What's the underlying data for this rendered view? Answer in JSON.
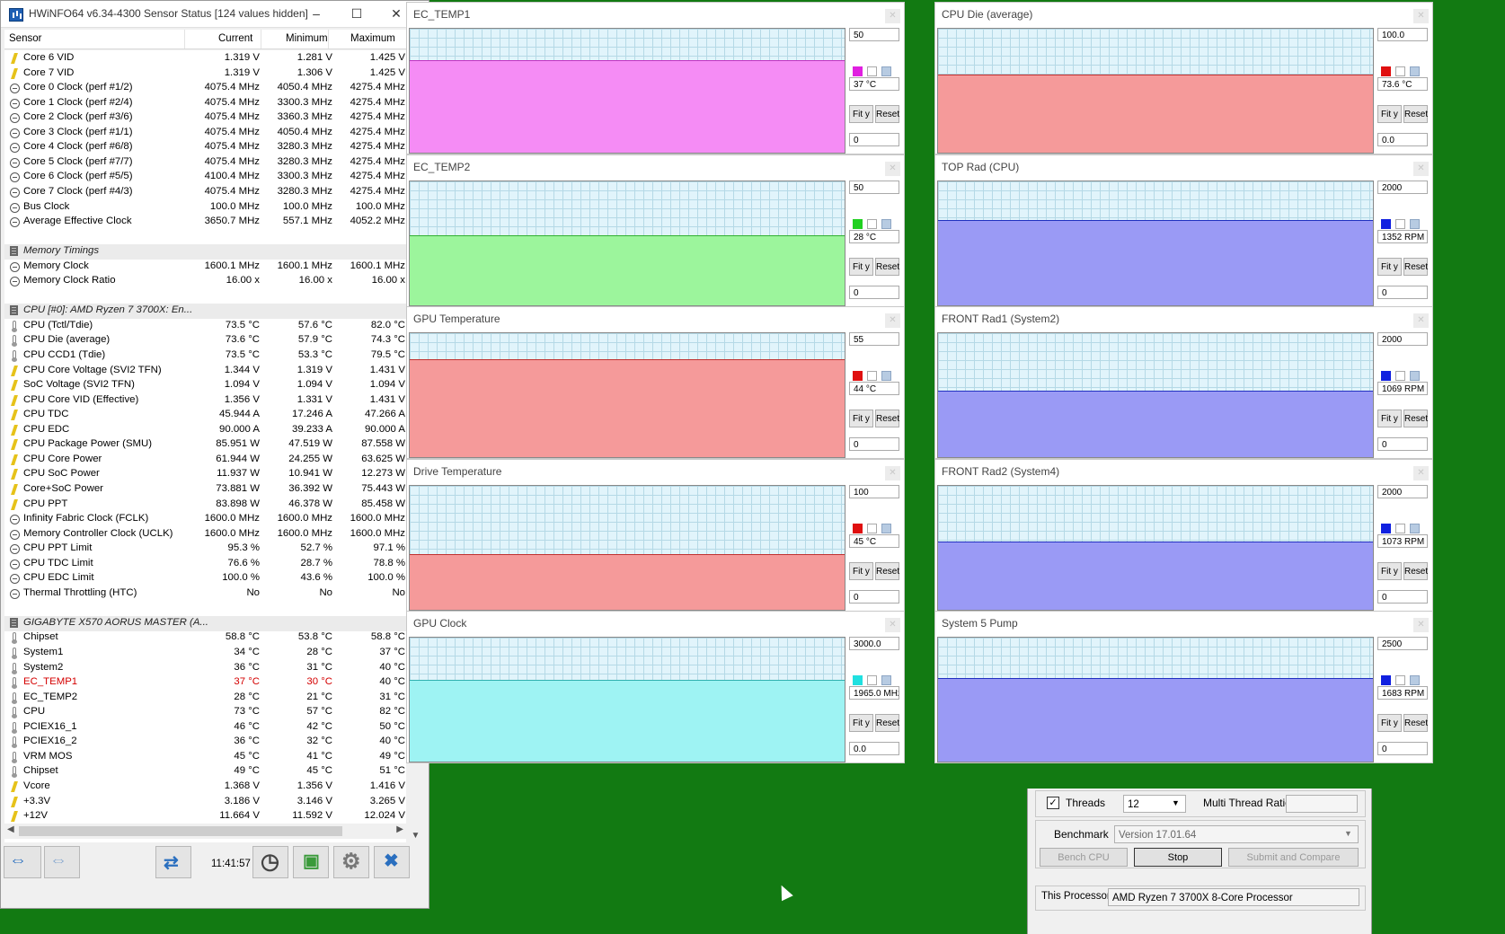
{
  "main_window": {
    "title": "HWiNFO64 v6.34-4300 Sensor Status [124 values hidden]",
    "columns": {
      "sensor": "Sensor",
      "current": "Current",
      "minimum": "Minimum",
      "maximum": "Maximum"
    },
    "rows": [
      {
        "icon": "volt",
        "name": "Core 6 VID",
        "cur": "1.319 V",
        "min": "1.281 V",
        "max": "1.425 V"
      },
      {
        "icon": "volt",
        "name": "Core 7 VID",
        "cur": "1.319 V",
        "min": "1.306 V",
        "max": "1.425 V"
      },
      {
        "icon": "clk",
        "name": "Core 0 Clock (perf #1/2)",
        "cur": "4075.4 MHz",
        "min": "4050.4 MHz",
        "max": "4275.4 MHz"
      },
      {
        "icon": "clk",
        "name": "Core 1 Clock (perf #2/4)",
        "cur": "4075.4 MHz",
        "min": "3300.3 MHz",
        "max": "4275.4 MHz"
      },
      {
        "icon": "clk",
        "name": "Core 2 Clock (perf #3/6)",
        "cur": "4075.4 MHz",
        "min": "3360.3 MHz",
        "max": "4275.4 MHz"
      },
      {
        "icon": "clk",
        "name": "Core 3 Clock (perf #1/1)",
        "cur": "4075.4 MHz",
        "min": "4050.4 MHz",
        "max": "4275.4 MHz"
      },
      {
        "icon": "clk",
        "name": "Core 4 Clock (perf #6/8)",
        "cur": "4075.4 MHz",
        "min": "3280.3 MHz",
        "max": "4275.4 MHz"
      },
      {
        "icon": "clk",
        "name": "Core 5 Clock (perf #7/7)",
        "cur": "4075.4 MHz",
        "min": "3280.3 MHz",
        "max": "4275.4 MHz"
      },
      {
        "icon": "clk",
        "name": "Core 6 Clock (perf #5/5)",
        "cur": "4100.4 MHz",
        "min": "3300.3 MHz",
        "max": "4275.4 MHz"
      },
      {
        "icon": "clk",
        "name": "Core 7 Clock (perf #4/3)",
        "cur": "4075.4 MHz",
        "min": "3280.3 MHz",
        "max": "4275.4 MHz"
      },
      {
        "icon": "clk",
        "name": "Bus Clock",
        "cur": "100.0 MHz",
        "min": "100.0 MHz",
        "max": "100.0 MHz"
      },
      {
        "icon": "clk",
        "name": "Average Effective Clock",
        "cur": "3650.7 MHz",
        "min": "557.1 MHz",
        "max": "4052.2 MHz"
      },
      {
        "icon": "",
        "name": "",
        "cur": "",
        "min": "",
        "max": ""
      },
      {
        "icon": "grp",
        "group": true,
        "name": "Memory Timings",
        "cur": "",
        "min": "",
        "max": ""
      },
      {
        "icon": "clk",
        "name": "Memory Clock",
        "cur": "1600.1 MHz",
        "min": "1600.1 MHz",
        "max": "1600.1 MHz"
      },
      {
        "icon": "clk",
        "name": "Memory Clock Ratio",
        "cur": "16.00 x",
        "min": "16.00 x",
        "max": "16.00 x"
      },
      {
        "icon": "",
        "name": "",
        "cur": "",
        "min": "",
        "max": ""
      },
      {
        "icon": "grp",
        "group": true,
        "name": "CPU [#0]: AMD Ryzen 7 3700X: En...",
        "cur": "",
        "min": "",
        "max": ""
      },
      {
        "icon": "temp",
        "name": "CPU (Tctl/Tdie)",
        "cur": "73.5 °C",
        "min": "57.6 °C",
        "max": "82.0 °C"
      },
      {
        "icon": "temp",
        "name": "CPU Die (average)",
        "cur": "73.6 °C",
        "min": "57.9 °C",
        "max": "74.3 °C"
      },
      {
        "icon": "temp",
        "name": "CPU CCD1 (Tdie)",
        "cur": "73.5 °C",
        "min": "53.3 °C",
        "max": "79.5 °C"
      },
      {
        "icon": "volt",
        "name": "CPU Core Voltage (SVI2 TFN)",
        "cur": "1.344 V",
        "min": "1.319 V",
        "max": "1.431 V"
      },
      {
        "icon": "volt",
        "name": "SoC Voltage (SVI2 TFN)",
        "cur": "1.094 V",
        "min": "1.094 V",
        "max": "1.094 V"
      },
      {
        "icon": "volt",
        "name": "CPU Core VID (Effective)",
        "cur": "1.356 V",
        "min": "1.331 V",
        "max": "1.431 V"
      },
      {
        "icon": "volt",
        "name": "CPU TDC",
        "cur": "45.944 A",
        "min": "17.246 A",
        "max": "47.266 A"
      },
      {
        "icon": "volt",
        "name": "CPU EDC",
        "cur": "90.000 A",
        "min": "39.233 A",
        "max": "90.000 A"
      },
      {
        "icon": "volt",
        "name": "CPU Package Power (SMU)",
        "cur": "85.951 W",
        "min": "47.519 W",
        "max": "87.558 W"
      },
      {
        "icon": "volt",
        "name": "CPU Core Power",
        "cur": "61.944 W",
        "min": "24.255 W",
        "max": "63.625 W"
      },
      {
        "icon": "volt",
        "name": "CPU SoC Power",
        "cur": "11.937 W",
        "min": "10.941 W",
        "max": "12.273 W"
      },
      {
        "icon": "volt",
        "name": "Core+SoC Power",
        "cur": "73.881 W",
        "min": "36.392 W",
        "max": "75.443 W"
      },
      {
        "icon": "volt",
        "name": "CPU PPT",
        "cur": "83.898 W",
        "min": "46.378 W",
        "max": "85.458 W"
      },
      {
        "icon": "clk",
        "name": "Infinity Fabric Clock (FCLK)",
        "cur": "1600.0 MHz",
        "min": "1600.0 MHz",
        "max": "1600.0 MHz"
      },
      {
        "icon": "clk",
        "name": "Memory Controller Clock (UCLK)",
        "cur": "1600.0 MHz",
        "min": "1600.0 MHz",
        "max": "1600.0 MHz"
      },
      {
        "icon": "clk",
        "name": "CPU PPT Limit",
        "cur": "95.3 %",
        "min": "52.7 %",
        "max": "97.1 %"
      },
      {
        "icon": "clk",
        "name": "CPU TDC Limit",
        "cur": "76.6 %",
        "min": "28.7 %",
        "max": "78.8 %"
      },
      {
        "icon": "clk",
        "name": "CPU EDC Limit",
        "cur": "100.0 %",
        "min": "43.6 %",
        "max": "100.0 %"
      },
      {
        "icon": "clk",
        "name": "Thermal Throttling (HTC)",
        "cur": "No",
        "min": "No",
        "max": "No"
      },
      {
        "icon": "",
        "name": "",
        "cur": "",
        "min": "",
        "max": ""
      },
      {
        "icon": "grp",
        "group": true,
        "name": "GIGABYTE X570 AORUS MASTER (A...",
        "cur": "",
        "min": "",
        "max": ""
      },
      {
        "icon": "temp",
        "name": "Chipset",
        "cur": "58.8 °C",
        "min": "53.8 °C",
        "max": "58.8 °C"
      },
      {
        "icon": "temp",
        "name": "System1",
        "cur": "34 °C",
        "min": "28 °C",
        "max": "37 °C"
      },
      {
        "icon": "temp",
        "name": "System2",
        "cur": "36 °C",
        "min": "31 °C",
        "max": "40 °C"
      },
      {
        "icon": "temp",
        "name": "EC_TEMP1",
        "red": true,
        "cur": "37 °C",
        "min": "30 °C",
        "max": "40 °C"
      },
      {
        "icon": "temp",
        "name": "EC_TEMP2",
        "cur": "28 °C",
        "min": "21 °C",
        "max": "31 °C"
      },
      {
        "icon": "temp",
        "name": "CPU",
        "cur": "73 °C",
        "min": "57 °C",
        "max": "82 °C"
      },
      {
        "icon": "temp",
        "name": "PCIEX16_1",
        "cur": "46 °C",
        "min": "42 °C",
        "max": "50 °C"
      },
      {
        "icon": "temp",
        "name": "PCIEX16_2",
        "cur": "36 °C",
        "min": "32 °C",
        "max": "40 °C"
      },
      {
        "icon": "temp",
        "name": "VRM MOS",
        "cur": "45 °C",
        "min": "41 °C",
        "max": "49 °C"
      },
      {
        "icon": "temp",
        "name": "Chipset",
        "cur": "49 °C",
        "min": "45 °C",
        "max": "51 °C"
      },
      {
        "icon": "volt",
        "name": "Vcore",
        "cur": "1.368 V",
        "min": "1.356 V",
        "max": "1.416 V"
      },
      {
        "icon": "volt",
        "name": "+3.3V",
        "cur": "3.186 V",
        "min": "3.146 V",
        "max": "3.265 V"
      },
      {
        "icon": "volt",
        "name": "+12V",
        "cur": "11.664 V",
        "min": "11.592 V",
        "max": "12.024 V"
      }
    ],
    "clock": "11:41:57"
  },
  "graphs": [
    {
      "title": "EC_TEMP1",
      "top": "50",
      "current": "37 °C",
      "bottom": "0",
      "color": "#f58cf5",
      "line": "#c032c0",
      "swatch": "#e020e0",
      "level": 0.74
    },
    {
      "title": "EC_TEMP2",
      "top": "50",
      "current": "28 °C",
      "bottom": "0",
      "color": "#9cf59c",
      "line": "#30b030",
      "swatch": "#20d020",
      "level": 0.56
    },
    {
      "title": "GPU Temperature",
      "top": "55",
      "current": "44 °C",
      "bottom": "0",
      "color": "#f59a9a",
      "line": "#c03030",
      "swatch": "#e01010",
      "level": 0.78
    },
    {
      "title": "Drive Temperature",
      "top": "100",
      "current": "45 °C",
      "bottom": "0",
      "color": "#f59a9a",
      "line": "#c03030",
      "swatch": "#e01010",
      "level": 0.44
    },
    {
      "title": "GPU Clock",
      "top": "3000.0",
      "current": "1965.0 MHz",
      "bottom": "0.0",
      "color": "#9ef3f3",
      "line": "#30b0b0",
      "swatch": "#20e0e0",
      "level": 0.655
    },
    {
      "title": "CPU Die (average)",
      "top": "100.0",
      "current": "73.6 °C",
      "bottom": "0.0",
      "color": "#f59a9a",
      "line": "#c03030",
      "swatch": "#e01010",
      "level": 0.62
    },
    {
      "title": "TOP Rad (CPU)",
      "top": "2000",
      "current": "1352 RPM",
      "bottom": "0",
      "color": "#9a9af5",
      "line": "#2030c0",
      "swatch": "#1020e0",
      "level": 0.68
    },
    {
      "title": "FRONT Rad1 (System2)",
      "top": "2000",
      "current": "1069 RPM",
      "bottom": "0",
      "color": "#9a9af5",
      "line": "#2030c0",
      "swatch": "#1020e0",
      "level": 0.53
    },
    {
      "title": "FRONT Rad2 (System4)",
      "top": "2000",
      "current": "1073 RPM",
      "bottom": "0",
      "color": "#9a9af5",
      "line": "#2030c0",
      "swatch": "#1020e0",
      "level": 0.54
    },
    {
      "title": "System 5 Pump",
      "top": "2500",
      "current": "1683 RPM",
      "bottom": "0",
      "color": "#9a9af5",
      "line": "#2030c0",
      "swatch": "#1020e0",
      "level": 0.67
    }
  ],
  "graph_buttons": {
    "fit": "Fit y",
    "reset": "Reset"
  },
  "cinebench": {
    "threads_label": "Threads",
    "threads_value": "12",
    "multi_ratio_label": "Multi Thread Ratio",
    "benchmark_label": "Benchmark",
    "benchmark_value": "Version 17.01.64",
    "bench_cpu": "Bench CPU",
    "stop": "Stop",
    "submit": "Submit and Compare",
    "processor_label": "This Processor",
    "processor_value": "AMD Ryzen 7 3700X 8-Core Processor"
  }
}
